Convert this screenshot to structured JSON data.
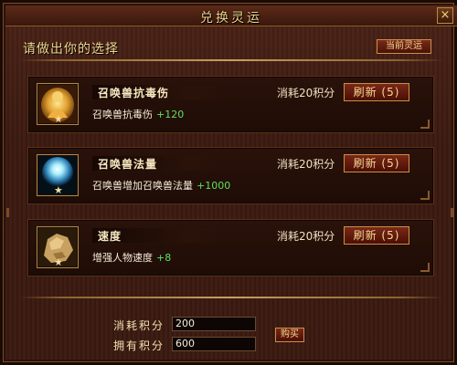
{
  "window": {
    "title": "兑换灵运",
    "close_label": "×"
  },
  "prompt": "请做出你的选择",
  "current_button": "当前灵运",
  "options": [
    {
      "name": "召唤兽抗毒伤",
      "description": "召唤兽抗毒伤",
      "bonus": "+120",
      "cost": "消耗20积分",
      "refresh_label": "刷新 (5)",
      "icon": "golden-buddha-icon"
    },
    {
      "name": "召唤兽法量",
      "description": "召唤兽增加召唤兽法量",
      "bonus": "+1000",
      "cost": "消耗20积分",
      "refresh_label": "刷新 (5)",
      "icon": "blue-orb-icon"
    },
    {
      "name": "速度",
      "description": "增强人物速度",
      "bonus": "+8",
      "cost": "消耗20积分",
      "refresh_label": "刷新 (5)",
      "icon": "gold-ore-icon"
    }
  ],
  "footer": {
    "consume_label": "消耗积分",
    "consume_value": "200",
    "own_label": "拥有积分",
    "own_value": "600",
    "buy_label": "购买"
  },
  "colors": {
    "bonus_green": "#5ee05e",
    "title_gold": "#f2d28a",
    "button_red": "#7a2818"
  }
}
